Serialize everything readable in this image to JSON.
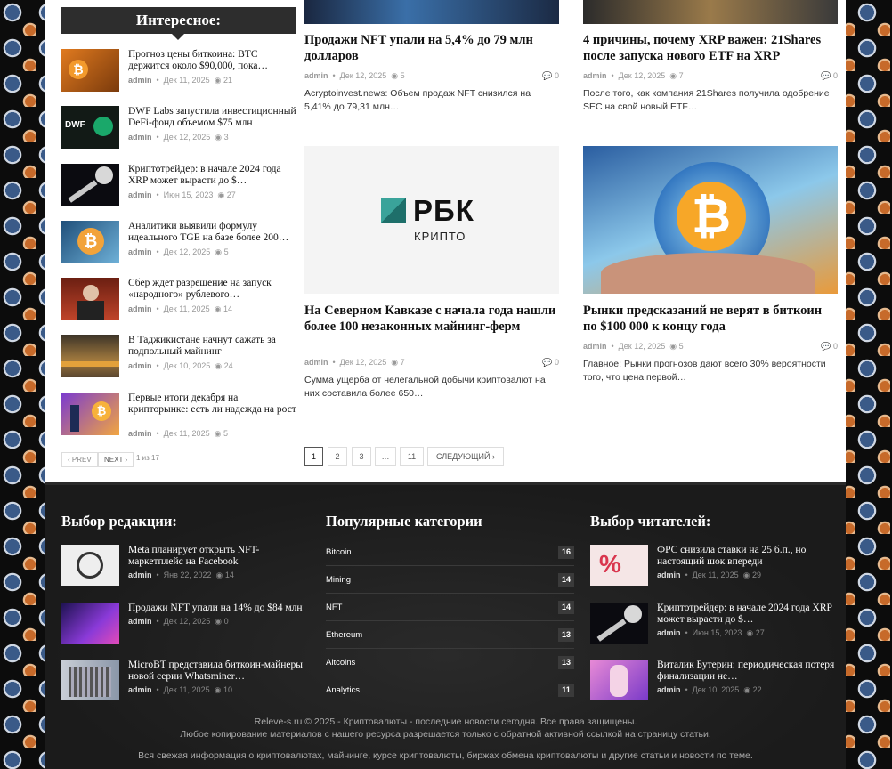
{
  "sidebar": {
    "heading": "Интересное:",
    "items": [
      {
        "title": "Прогноз цены биткоина: BTC держится около $90,000, пока…",
        "author": "admin",
        "date": "Дек 11, 2025",
        "views": "21"
      },
      {
        "title": "DWF Labs запустила инвестиционный DeFi-фонд объемом $75 млн",
        "author": "admin",
        "date": "Дек 12, 2025",
        "views": "3"
      },
      {
        "title": "Криптотрейдер: в начале 2024 года XRP может вырасти до $…",
        "author": "admin",
        "date": "Июн 15, 2023",
        "views": "27"
      },
      {
        "title": "Аналитики выявили формулу идеального TGE на базе более 200…",
        "author": "admin",
        "date": "Дек 12, 2025",
        "views": "5"
      },
      {
        "title": "Сбер ждет разрешение на запуск «народного» рублевого…",
        "author": "admin",
        "date": "Дек 11, 2025",
        "views": "14"
      },
      {
        "title": "В Таджикистане начнут сажать за подпольный майнинг",
        "author": "admin",
        "date": "Дек 10, 2025",
        "views": "24"
      },
      {
        "title": "Первые итоги декабря на крипторынке: есть ли надежда на рост",
        "author": "admin",
        "date": "Дек 11, 2025",
        "views": "5"
      }
    ],
    "prev": "‹ PREV",
    "next": "NEXT ›",
    "page_info": "1 из 17"
  },
  "cards": [
    {
      "title": "Продажи NFT упали на 5,4% до 79 млн долларов",
      "author": "admin",
      "date": "Дек 12, 2025",
      "views": "5",
      "comments": "0",
      "excerpt": "Acryptoinvest.news: Объем продаж NFT снизился на 5,41% до 79,31 млн…"
    },
    {
      "title": "4 причины, почему XRP важен: 21Shares после запуска нового ETF на XRP",
      "author": "admin",
      "date": "Дек 12, 2025",
      "views": "7",
      "comments": "0",
      "excerpt": "После того, как компания 21Shares получила одобрение SEC на свой новый ETF…"
    },
    {
      "title": "На Северном Кавказе с начала года нашли более 100 незаконных майнинг-ферм",
      "author": "admin",
      "date": "Дек 12, 2025",
      "views": "7",
      "comments": "0",
      "excerpt": "Сумма ущерба от нелегальной добычи криптовалют на них составила более 650…",
      "logo_main": "РБК",
      "logo_sub": "КРИПТО"
    },
    {
      "title": "Рынки предсказаний не верят в биткоин по $100 000 к концу года",
      "author": "admin",
      "date": "Дек 12, 2025",
      "views": "5",
      "comments": "0",
      "excerpt": "Главное: Рынки прогнозов дают всего 30% вероятности того, что цена первой…"
    }
  ],
  "pagination": {
    "pages": [
      "1",
      "2",
      "3",
      "…",
      "11"
    ],
    "next": "СЛЕДУЮЩИЙ ›"
  },
  "footer": {
    "editors": {
      "heading": "Выбор редакции:",
      "items": [
        {
          "title": "Meta планирует открыть NFT-маркетплейс на Facebook",
          "author": "admin",
          "date": "Янв 22, 2022",
          "views": "14"
        },
        {
          "title": "Продажи NFT упали на 14% до $84 млн",
          "author": "admin",
          "date": "Дек 12, 2025",
          "views": "0"
        },
        {
          "title": "MicroBT представила биткоин-майнеры новой серии Whatsminer…",
          "author": "admin",
          "date": "Дек 11, 2025",
          "views": "10"
        }
      ]
    },
    "categories": {
      "heading": "Популярные категории",
      "items": [
        {
          "name": "Bitcoin",
          "count": "16"
        },
        {
          "name": "Mining",
          "count": "14"
        },
        {
          "name": "NFT",
          "count": "14"
        },
        {
          "name": "Ethereum",
          "count": "13"
        },
        {
          "name": "Altcoins",
          "count": "13"
        },
        {
          "name": "Analytics",
          "count": "11"
        }
      ]
    },
    "readers": {
      "heading": "Выбор читателей:",
      "items": [
        {
          "title": "ФРС снизила ставки на 25 б.п., но настоящий шок впереди",
          "author": "admin",
          "date": "Дек 11, 2025",
          "views": "29"
        },
        {
          "title": "Криптотрейдер: в начале 2024 года XRP может вырасти до $…",
          "author": "admin",
          "date": "Июн 15, 2023",
          "views": "27"
        },
        {
          "title": "Виталик Бутерин: периодическая потеря финализации не…",
          "author": "admin",
          "date": "Дек 10, 2025",
          "views": "22"
        }
      ]
    },
    "copyright": "Releve-s.ru © 2025 - Криптовалюты - последние новости сегодня. Все права защищены.",
    "notice": "Любое копирование материалов с нашего ресурса разрешается только с обратной активной ссылкой на страницу статьи.",
    "about": "Вся свежая информация о криптовалютах, майнинге, курсе криптовалюты, биржах обмена криптовалюты и другие статьи и новости по теме."
  }
}
